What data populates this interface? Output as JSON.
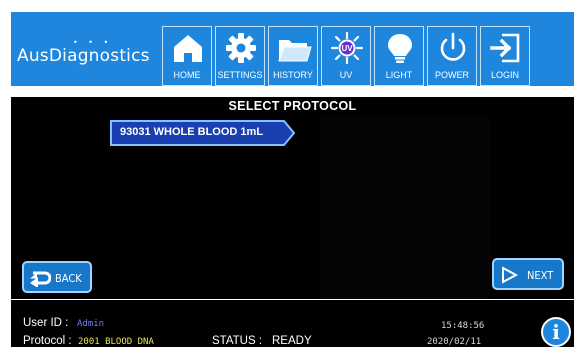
{
  "header": {
    "logo_text": "AusDiagnostics",
    "nav": [
      {
        "label": "HOME",
        "icon": "home-icon"
      },
      {
        "label": "SETTINGS",
        "icon": "gear-icon"
      },
      {
        "label": "HISTORY",
        "icon": "folder-icon"
      },
      {
        "label": "UV",
        "icon": "uv-lamp-icon"
      },
      {
        "label": "LIGHT",
        "icon": "lightbulb-icon"
      },
      {
        "label": "POWER",
        "icon": "power-icon"
      },
      {
        "label": "LOGIN",
        "icon": "login-icon"
      }
    ]
  },
  "main": {
    "title": "SELECT PROTOCOL",
    "protocols": [
      {
        "label": "93031 WHOLE BLOOD 1mL",
        "selected": true
      }
    ],
    "back_label": "BACK",
    "next_label": "NEXT"
  },
  "footer": {
    "user_id_label": "User ID :",
    "user_id_value": "Admin",
    "protocol_label": "Protocol :",
    "protocol_value": "2001 BLOOD DNA",
    "status_label": "STATUS :",
    "status_value": "READY",
    "time": "15:48:56",
    "date": "2020/02/11",
    "info_glyph": "i"
  },
  "colors": {
    "header_blue": "#1e86dd",
    "panel_black": "#000000",
    "protocol_highlight": "#1a3fb0",
    "user_id_color": "#6f7dff",
    "protocol_value_color": "#e8e64a"
  }
}
